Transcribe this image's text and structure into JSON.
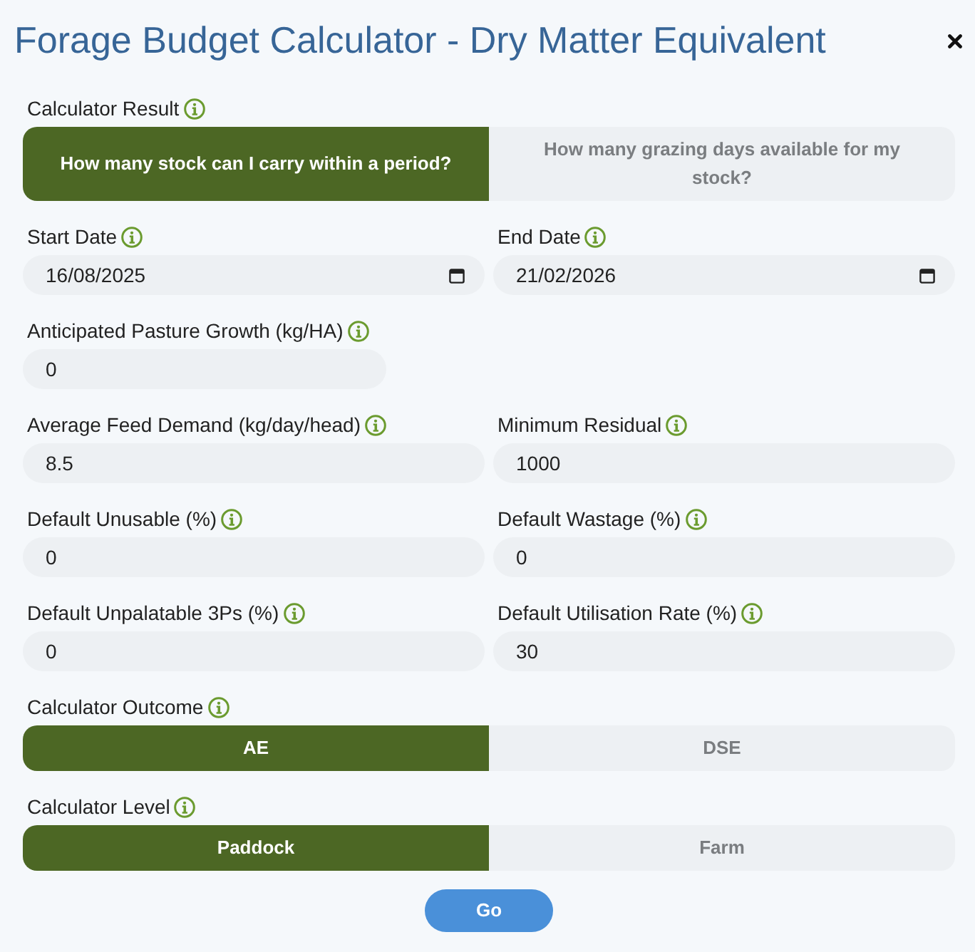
{
  "window": {
    "title": "Forage Budget Calculator - Dry Matter Equivalent"
  },
  "sections": [
    {
      "kind": "toggle",
      "label": "Calculator Result",
      "options": [
        {
          "label": "How many stock can I carry within a period?",
          "selected": true
        },
        {
          "label": "How many grazing days available for my stock?",
          "selected": false
        }
      ]
    },
    {
      "kind": "fields",
      "fields": [
        {
          "kind": "date",
          "label": "Start Date",
          "value": "16/08/2025"
        },
        {
          "kind": "date",
          "label": "End Date",
          "value": "21/02/2026"
        }
      ]
    },
    {
      "kind": "fields",
      "fields": [
        {
          "kind": "number",
          "label": "Anticipated Pasture Growth (kg/HA)",
          "value": "0"
        }
      ]
    },
    {
      "kind": "fields",
      "fields": [
        {
          "kind": "number",
          "label": "Average Feed Demand (kg/day/head)",
          "value": "8.5"
        },
        {
          "kind": "number",
          "label": "Minimum Residual",
          "value": "1000"
        }
      ]
    },
    {
      "kind": "fields",
      "fields": [
        {
          "kind": "number",
          "label": "Default Unusable (%)",
          "value": "0"
        },
        {
          "kind": "number",
          "label": "Default Wastage (%)",
          "value": "0"
        }
      ]
    },
    {
      "kind": "fields",
      "fields": [
        {
          "kind": "number",
          "label": "Default Unpalatable 3Ps (%)",
          "value": "0"
        },
        {
          "kind": "number",
          "label": "Default Utilisation Rate (%)",
          "value": "30"
        }
      ]
    },
    {
      "kind": "toggle",
      "label": "Calculator Outcome",
      "options": [
        {
          "label": "AE",
          "selected": true
        },
        {
          "label": "DSE",
          "selected": false
        }
      ]
    },
    {
      "kind": "toggle",
      "label": "Calculator Level",
      "options": [
        {
          "label": "Paddock",
          "selected": true
        },
        {
          "label": "Farm",
          "selected": false
        }
      ]
    }
  ],
  "go_button": {
    "label": "Go"
  }
}
